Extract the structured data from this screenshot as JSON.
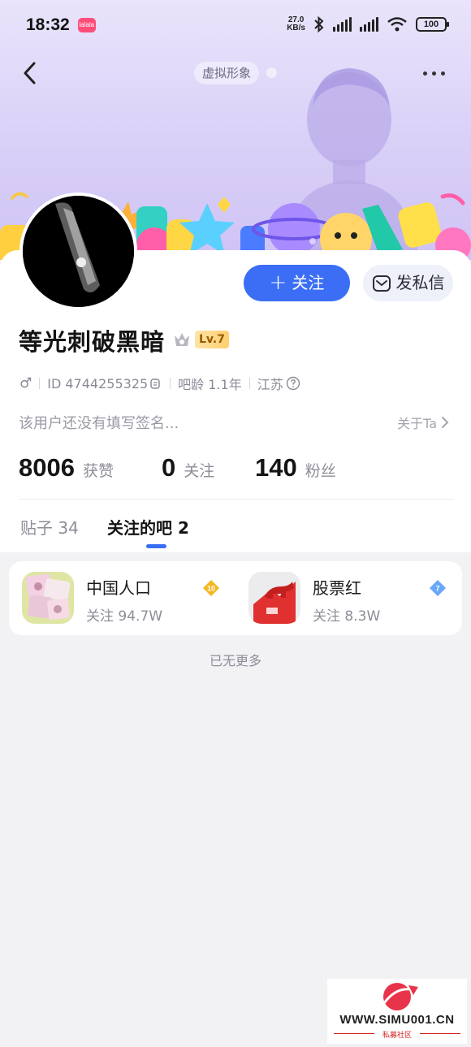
{
  "status_bar": {
    "time": "18:32",
    "app_badge": "lalala",
    "net_speed_value": "27.0",
    "net_speed_unit": "KB/s",
    "battery": "100"
  },
  "header": {
    "avatar_chip": "虚拟形象"
  },
  "profile": {
    "username": "等光刺破黑暗",
    "level": "Lv.7",
    "gender_symbol": "♂",
    "id_text": "ID 4744255325",
    "bar_age": "吧龄 1.1年",
    "location": "江苏",
    "bio": "该用户还没有填写签名...",
    "about_link": "关于Ta"
  },
  "actions": {
    "follow_label": "关注",
    "message_label": "发私信"
  },
  "stats": [
    {
      "value": "8006",
      "label": "获赞"
    },
    {
      "value": "0",
      "label": "关注"
    },
    {
      "value": "140",
      "label": "粉丝"
    }
  ],
  "tabs": [
    {
      "label": "贴子 34",
      "active": false
    },
    {
      "label": "关注的吧 2",
      "active": true
    }
  ],
  "followed_bars": [
    {
      "name": "中国人口",
      "follow_text": "关注 94.7W",
      "badge_level": "10",
      "badge_color": "#f5b623"
    },
    {
      "name": "股票红",
      "follow_text": "关注 8.3W",
      "badge_level": "7",
      "badge_color": "#6aa8f7"
    }
  ],
  "no_more_text": "已无更多",
  "watermark": {
    "url": "WWW.SIMU001.CN",
    "subtitle": "私募社区"
  },
  "colors": {
    "accent": "#3b6ef5",
    "banner": "#d9d0f7",
    "background": "#f2f2f5"
  }
}
